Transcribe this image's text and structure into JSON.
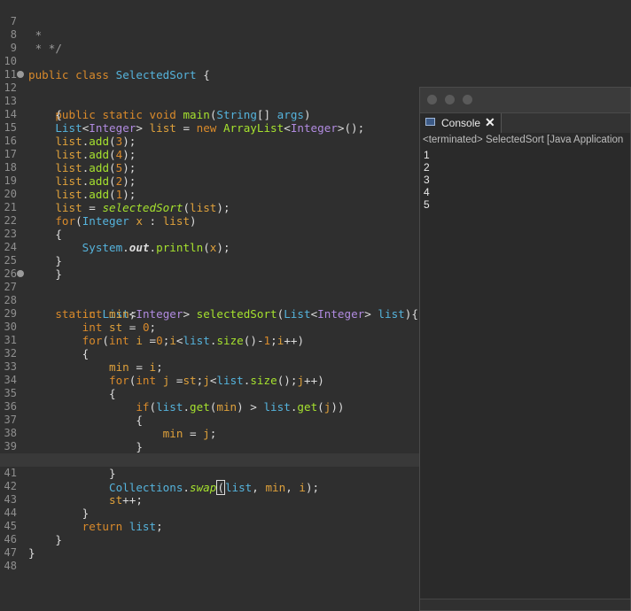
{
  "editor": {
    "lines": [
      {
        "n": "7",
        "t": " *"
      },
      {
        "n": "8",
        "t": " * */"
      },
      {
        "n": "9",
        "t": ""
      },
      {
        "n": "10",
        "t": "public class SelectedSort {"
      },
      {
        "n": "11",
        "t": ""
      },
      {
        "n": "12",
        "t": "    public static void main(String[] args)"
      },
      {
        "n": "13",
        "t": "    {"
      },
      {
        "n": "14",
        "t": "    List<Integer> list = new ArrayList<Integer>();"
      },
      {
        "n": "15",
        "t": "    list.add(3);"
      },
      {
        "n": "16",
        "t": "    list.add(4);"
      },
      {
        "n": "17",
        "t": "    list.add(5);"
      },
      {
        "n": "18",
        "t": "    list.add(2);"
      },
      {
        "n": "19",
        "t": "    list.add(1);"
      },
      {
        "n": "20",
        "t": "    list = selectedSort(list);"
      },
      {
        "n": "21",
        "t": "    for(Integer x : list)"
      },
      {
        "n": "22",
        "t": "    {"
      },
      {
        "n": "23",
        "t": "        System.out.println(x);"
      },
      {
        "n": "24",
        "t": "    }"
      },
      {
        "n": "25",
        "t": "    }"
      },
      {
        "n": "26",
        "t": ""
      },
      {
        "n": "27",
        "t": "    static List<Integer> selectedSort(List<Integer> list){"
      },
      {
        "n": "28",
        "t": "        int min;"
      },
      {
        "n": "29",
        "t": "        int st = 0;"
      },
      {
        "n": "30",
        "t": "        for(int i =0;i<list.size()-1;i++)"
      },
      {
        "n": "31",
        "t": "        {"
      },
      {
        "n": "32",
        "t": "            min = i;"
      },
      {
        "n": "33",
        "t": "            for(int j =st;j<list.size();j++)"
      },
      {
        "n": "34",
        "t": "            {"
      },
      {
        "n": "35",
        "t": "                if(list.get(min) > list.get(j))"
      },
      {
        "n": "36",
        "t": "                {"
      },
      {
        "n": "37",
        "t": "                    min = j;"
      },
      {
        "n": "38",
        "t": "                }"
      },
      {
        "n": "39",
        "t": ""
      },
      {
        "n": "40",
        "t": "            }"
      },
      {
        "n": "41",
        "t": "            Collections.swap(list, min, i);"
      },
      {
        "n": "42",
        "t": "            st++;"
      },
      {
        "n": "43",
        "t": "        }"
      },
      {
        "n": "44",
        "t": "        return list;"
      },
      {
        "n": "45",
        "t": "    }"
      },
      {
        "n": "46",
        "t": "}"
      },
      {
        "n": "47",
        "t": ""
      },
      {
        "n": "48",
        "t": ""
      }
    ]
  },
  "console": {
    "tab_label": "Console",
    "tab_close": "✕",
    "status": "<terminated> SelectedSort [Java Application",
    "output": [
      "1",
      "2",
      "3",
      "4",
      "5"
    ]
  },
  "colors": {
    "background": "#2f2f2f",
    "keyword": "#d98a2b",
    "type": "#b18be0",
    "method": "#a6e22e",
    "variable": "#dfa13b",
    "identifier": "#55b3dc"
  }
}
